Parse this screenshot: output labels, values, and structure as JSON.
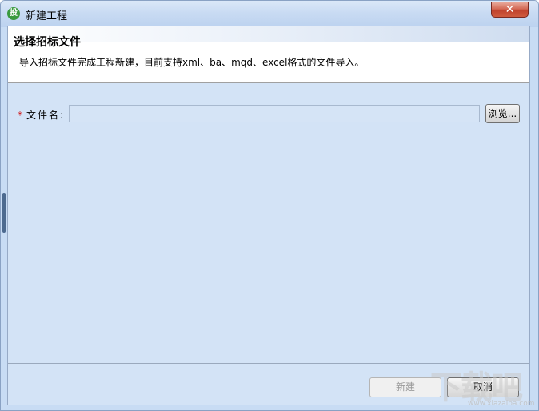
{
  "window": {
    "title": "新建工程",
    "app_icon_glyph": "投",
    "close_glyph": "✕"
  },
  "header": {
    "title": "选择招标文件",
    "description": "导入招标文件完成工程新建，目前支持xml、ba、mqd、excel格式的文件导入。"
  },
  "form": {
    "required_mark": "*",
    "file_label": "文件名:",
    "file_value": "",
    "browse_label": "浏览..."
  },
  "footer": {
    "new_label": "新建",
    "cancel_label": "取消"
  },
  "watermark": {
    "text": "下载吧",
    "url": "www.xiazaiba.com"
  },
  "colors": {
    "client_bg": "#d3e3f6",
    "title_bar": "#c9dbf3",
    "close_button": "#c0432e",
    "required": "#d00000"
  }
}
